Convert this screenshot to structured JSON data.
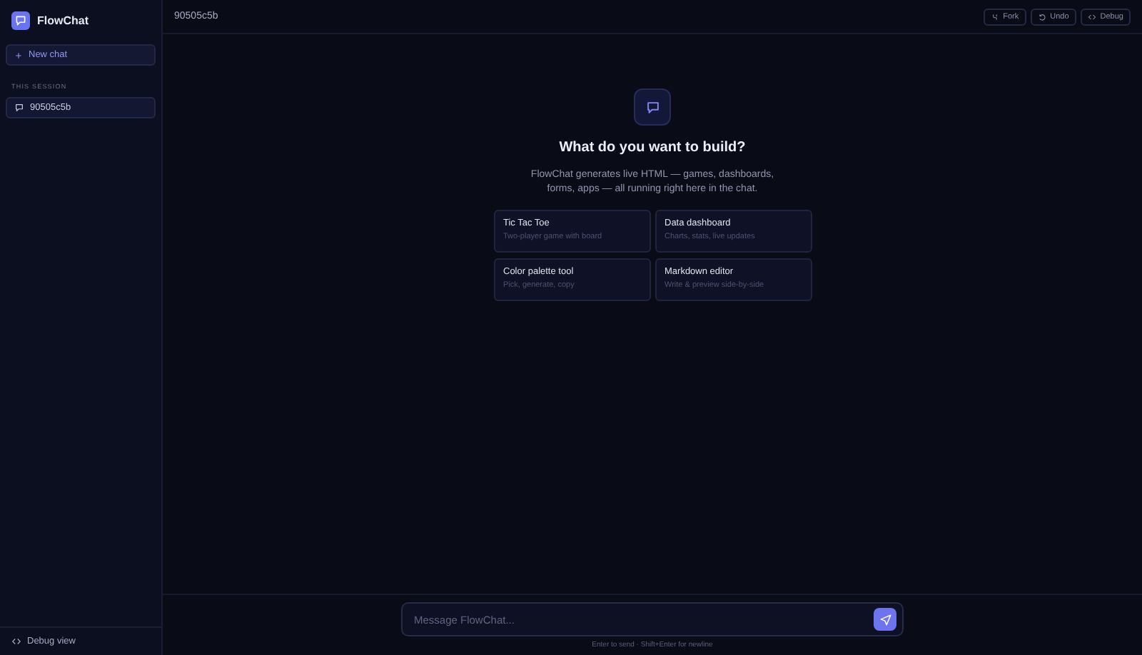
{
  "app": {
    "name": "FlowChat"
  },
  "sidebar": {
    "new_chat": "New chat",
    "section": "THIS SESSION",
    "sessions": [
      {
        "label": "90505c5b",
        "selected": true
      }
    ],
    "footer": "Debug view"
  },
  "header": {
    "title": "90505c5b",
    "actions": [
      {
        "kind": "fork",
        "label": "Fork"
      },
      {
        "kind": "undo",
        "label": "Undo"
      },
      {
        "kind": "debug",
        "label": "Debug"
      }
    ]
  },
  "hero": {
    "title": "What do you want to build?",
    "description": "FlowChat generates live HTML — games, dashboards, forms, apps — all running right here in the chat."
  },
  "suggestions": [
    {
      "title": "Tic Tac Toe",
      "subtitle": "Two-player game with board"
    },
    {
      "title": "Data dashboard",
      "subtitle": "Charts, stats, live updates"
    },
    {
      "title": "Color palette tool",
      "subtitle": "Pick, generate, copy"
    },
    {
      "title": "Markdown editor",
      "subtitle": "Write & preview side-by-side"
    }
  ],
  "composer": {
    "placeholder": "Message FlowChat...",
    "hint": "Enter to send · Shift+Enter for newline"
  }
}
